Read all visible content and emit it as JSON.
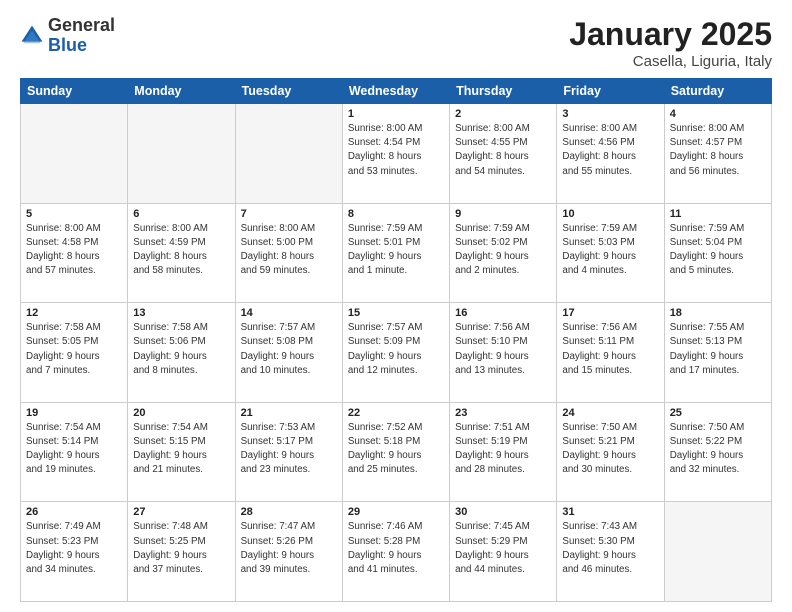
{
  "header": {
    "logo_general": "General",
    "logo_blue": "Blue",
    "title": "January 2025",
    "subtitle": "Casella, Liguria, Italy"
  },
  "weekdays": [
    "Sunday",
    "Monday",
    "Tuesday",
    "Wednesday",
    "Thursday",
    "Friday",
    "Saturday"
  ],
  "weeks": [
    [
      {
        "day": "",
        "info": ""
      },
      {
        "day": "",
        "info": ""
      },
      {
        "day": "",
        "info": ""
      },
      {
        "day": "1",
        "info": "Sunrise: 8:00 AM\nSunset: 4:54 PM\nDaylight: 8 hours\nand 53 minutes."
      },
      {
        "day": "2",
        "info": "Sunrise: 8:00 AM\nSunset: 4:55 PM\nDaylight: 8 hours\nand 54 minutes."
      },
      {
        "day": "3",
        "info": "Sunrise: 8:00 AM\nSunset: 4:56 PM\nDaylight: 8 hours\nand 55 minutes."
      },
      {
        "day": "4",
        "info": "Sunrise: 8:00 AM\nSunset: 4:57 PM\nDaylight: 8 hours\nand 56 minutes."
      }
    ],
    [
      {
        "day": "5",
        "info": "Sunrise: 8:00 AM\nSunset: 4:58 PM\nDaylight: 8 hours\nand 57 minutes."
      },
      {
        "day": "6",
        "info": "Sunrise: 8:00 AM\nSunset: 4:59 PM\nDaylight: 8 hours\nand 58 minutes."
      },
      {
        "day": "7",
        "info": "Sunrise: 8:00 AM\nSunset: 5:00 PM\nDaylight: 8 hours\nand 59 minutes."
      },
      {
        "day": "8",
        "info": "Sunrise: 7:59 AM\nSunset: 5:01 PM\nDaylight: 9 hours\nand 1 minute."
      },
      {
        "day": "9",
        "info": "Sunrise: 7:59 AM\nSunset: 5:02 PM\nDaylight: 9 hours\nand 2 minutes."
      },
      {
        "day": "10",
        "info": "Sunrise: 7:59 AM\nSunset: 5:03 PM\nDaylight: 9 hours\nand 4 minutes."
      },
      {
        "day": "11",
        "info": "Sunrise: 7:59 AM\nSunset: 5:04 PM\nDaylight: 9 hours\nand 5 minutes."
      }
    ],
    [
      {
        "day": "12",
        "info": "Sunrise: 7:58 AM\nSunset: 5:05 PM\nDaylight: 9 hours\nand 7 minutes."
      },
      {
        "day": "13",
        "info": "Sunrise: 7:58 AM\nSunset: 5:06 PM\nDaylight: 9 hours\nand 8 minutes."
      },
      {
        "day": "14",
        "info": "Sunrise: 7:57 AM\nSunset: 5:08 PM\nDaylight: 9 hours\nand 10 minutes."
      },
      {
        "day": "15",
        "info": "Sunrise: 7:57 AM\nSunset: 5:09 PM\nDaylight: 9 hours\nand 12 minutes."
      },
      {
        "day": "16",
        "info": "Sunrise: 7:56 AM\nSunset: 5:10 PM\nDaylight: 9 hours\nand 13 minutes."
      },
      {
        "day": "17",
        "info": "Sunrise: 7:56 AM\nSunset: 5:11 PM\nDaylight: 9 hours\nand 15 minutes."
      },
      {
        "day": "18",
        "info": "Sunrise: 7:55 AM\nSunset: 5:13 PM\nDaylight: 9 hours\nand 17 minutes."
      }
    ],
    [
      {
        "day": "19",
        "info": "Sunrise: 7:54 AM\nSunset: 5:14 PM\nDaylight: 9 hours\nand 19 minutes."
      },
      {
        "day": "20",
        "info": "Sunrise: 7:54 AM\nSunset: 5:15 PM\nDaylight: 9 hours\nand 21 minutes."
      },
      {
        "day": "21",
        "info": "Sunrise: 7:53 AM\nSunset: 5:17 PM\nDaylight: 9 hours\nand 23 minutes."
      },
      {
        "day": "22",
        "info": "Sunrise: 7:52 AM\nSunset: 5:18 PM\nDaylight: 9 hours\nand 25 minutes."
      },
      {
        "day": "23",
        "info": "Sunrise: 7:51 AM\nSunset: 5:19 PM\nDaylight: 9 hours\nand 28 minutes."
      },
      {
        "day": "24",
        "info": "Sunrise: 7:50 AM\nSunset: 5:21 PM\nDaylight: 9 hours\nand 30 minutes."
      },
      {
        "day": "25",
        "info": "Sunrise: 7:50 AM\nSunset: 5:22 PM\nDaylight: 9 hours\nand 32 minutes."
      }
    ],
    [
      {
        "day": "26",
        "info": "Sunrise: 7:49 AM\nSunset: 5:23 PM\nDaylight: 9 hours\nand 34 minutes."
      },
      {
        "day": "27",
        "info": "Sunrise: 7:48 AM\nSunset: 5:25 PM\nDaylight: 9 hours\nand 37 minutes."
      },
      {
        "day": "28",
        "info": "Sunrise: 7:47 AM\nSunset: 5:26 PM\nDaylight: 9 hours\nand 39 minutes."
      },
      {
        "day": "29",
        "info": "Sunrise: 7:46 AM\nSunset: 5:28 PM\nDaylight: 9 hours\nand 41 minutes."
      },
      {
        "day": "30",
        "info": "Sunrise: 7:45 AM\nSunset: 5:29 PM\nDaylight: 9 hours\nand 44 minutes."
      },
      {
        "day": "31",
        "info": "Sunrise: 7:43 AM\nSunset: 5:30 PM\nDaylight: 9 hours\nand 46 minutes."
      },
      {
        "day": "",
        "info": ""
      }
    ]
  ]
}
